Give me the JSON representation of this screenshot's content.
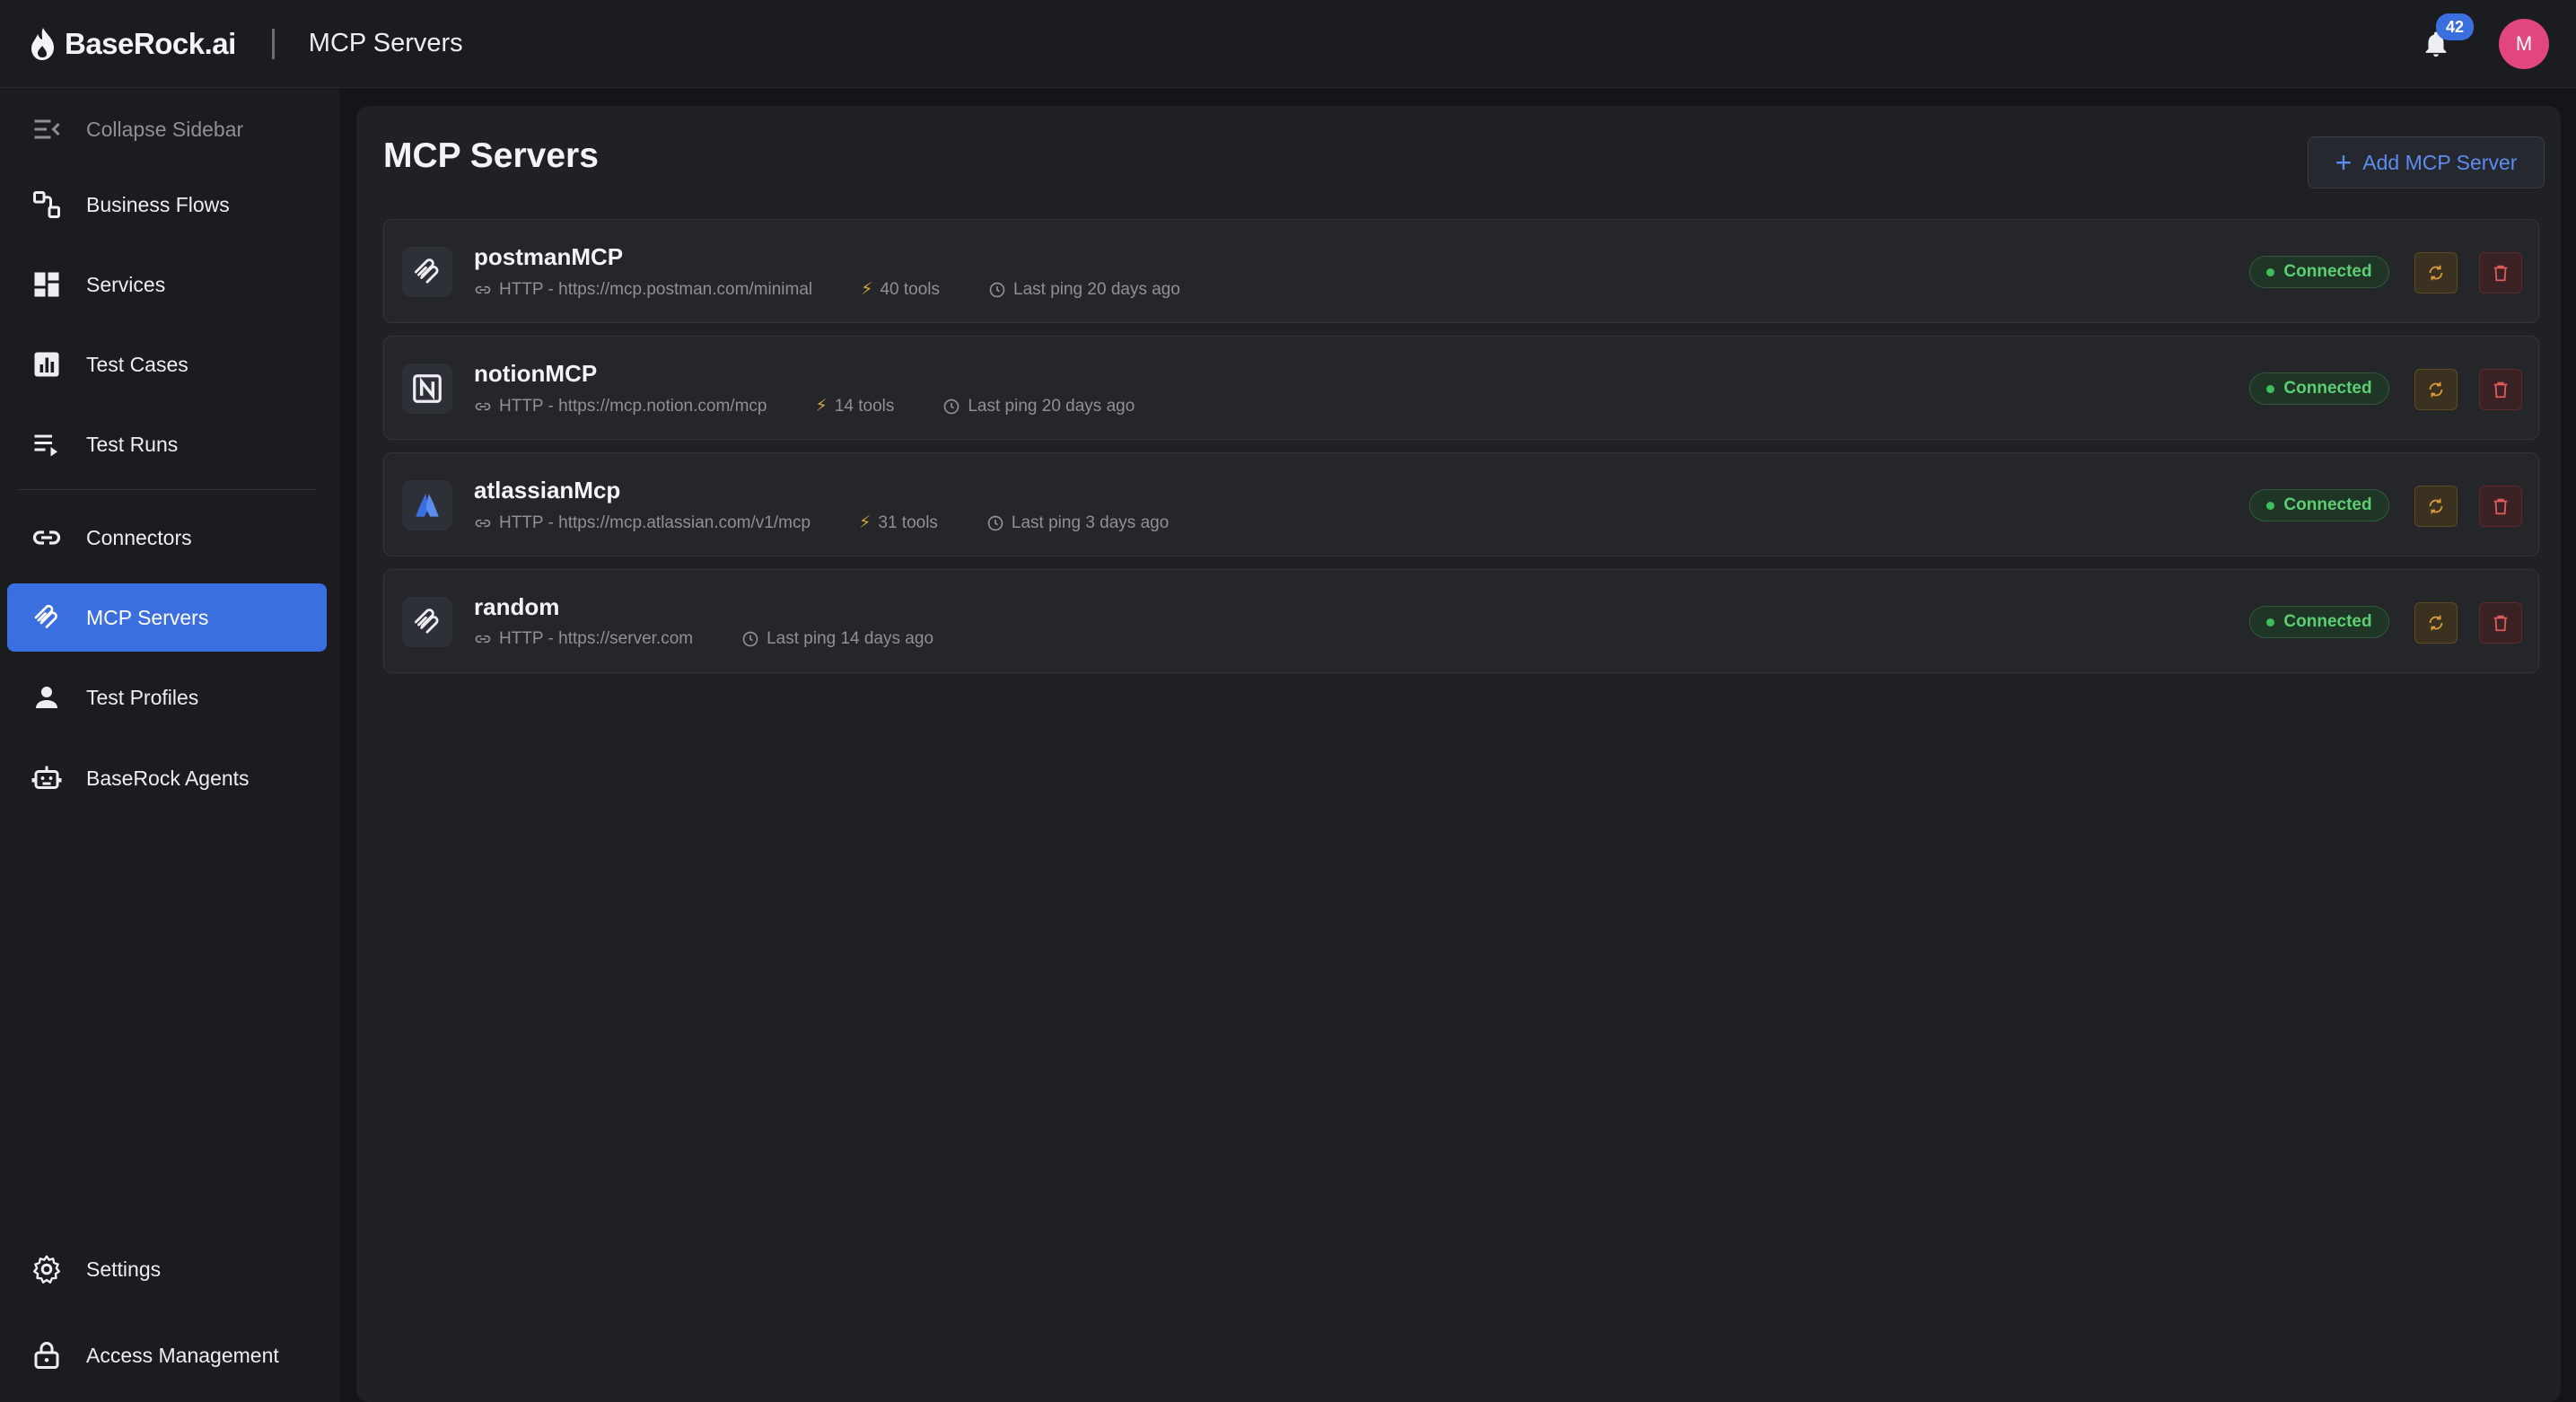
{
  "header": {
    "brand": "BaseRock.ai",
    "page_title": "MCP Servers",
    "notifications_count": "42",
    "avatar_initial": "M"
  },
  "sidebar": {
    "items": [
      {
        "label": "Collapse Sidebar",
        "icon": "collapse-sidebar-icon"
      },
      {
        "label": "Business Flows",
        "icon": "flow-icon"
      },
      {
        "label": "Services",
        "icon": "dashboard-icon"
      },
      {
        "label": "Test Cases",
        "icon": "chart-icon"
      },
      {
        "label": "Test Runs",
        "icon": "playlist-play-icon"
      },
      {
        "label": "Connectors",
        "icon": "link-icon"
      },
      {
        "label": "MCP Servers",
        "icon": "mcp-icon"
      },
      {
        "label": "Test Profiles",
        "icon": "person-icon"
      },
      {
        "label": "BaseRock Agents",
        "icon": "robot-icon"
      },
      {
        "label": "Access Management",
        "icon": "lock-icon"
      },
      {
        "label": "Settings",
        "icon": "gear-icon"
      }
    ],
    "active": "MCP Servers"
  },
  "main": {
    "title": "MCP Servers",
    "add_button_label": "Add MCP Server",
    "servers": [
      {
        "name": "postmanMCP",
        "url": "HTTP - https://mcp.postman.com/minimal",
        "tools": "40 tools",
        "last_ping": "Last ping 20 days ago",
        "status": "Connected",
        "icon": "mcp-icon"
      },
      {
        "name": "notionMCP",
        "url": "HTTP - https://mcp.notion.com/mcp",
        "tools": "14 tools",
        "last_ping": "Last ping 20 days ago",
        "status": "Connected",
        "icon": "notion-icon"
      },
      {
        "name": "atlassianMcp",
        "url": "HTTP - https://mcp.atlassian.com/v1/mcp",
        "tools": "31 tools",
        "last_ping": "Last ping 3 days ago",
        "status": "Connected",
        "icon": "atlassian-icon"
      },
      {
        "name": "random",
        "url": "HTTP - https://server.com",
        "tools": null,
        "last_ping": "Last ping 14 days ago",
        "status": "Connected",
        "icon": "mcp-icon"
      }
    ]
  },
  "colors": {
    "accent": "#3b6fe0",
    "connected_green": "#5ccf73",
    "refresh_orange": "#d99a3a",
    "delete_red": "#e05a5a"
  }
}
